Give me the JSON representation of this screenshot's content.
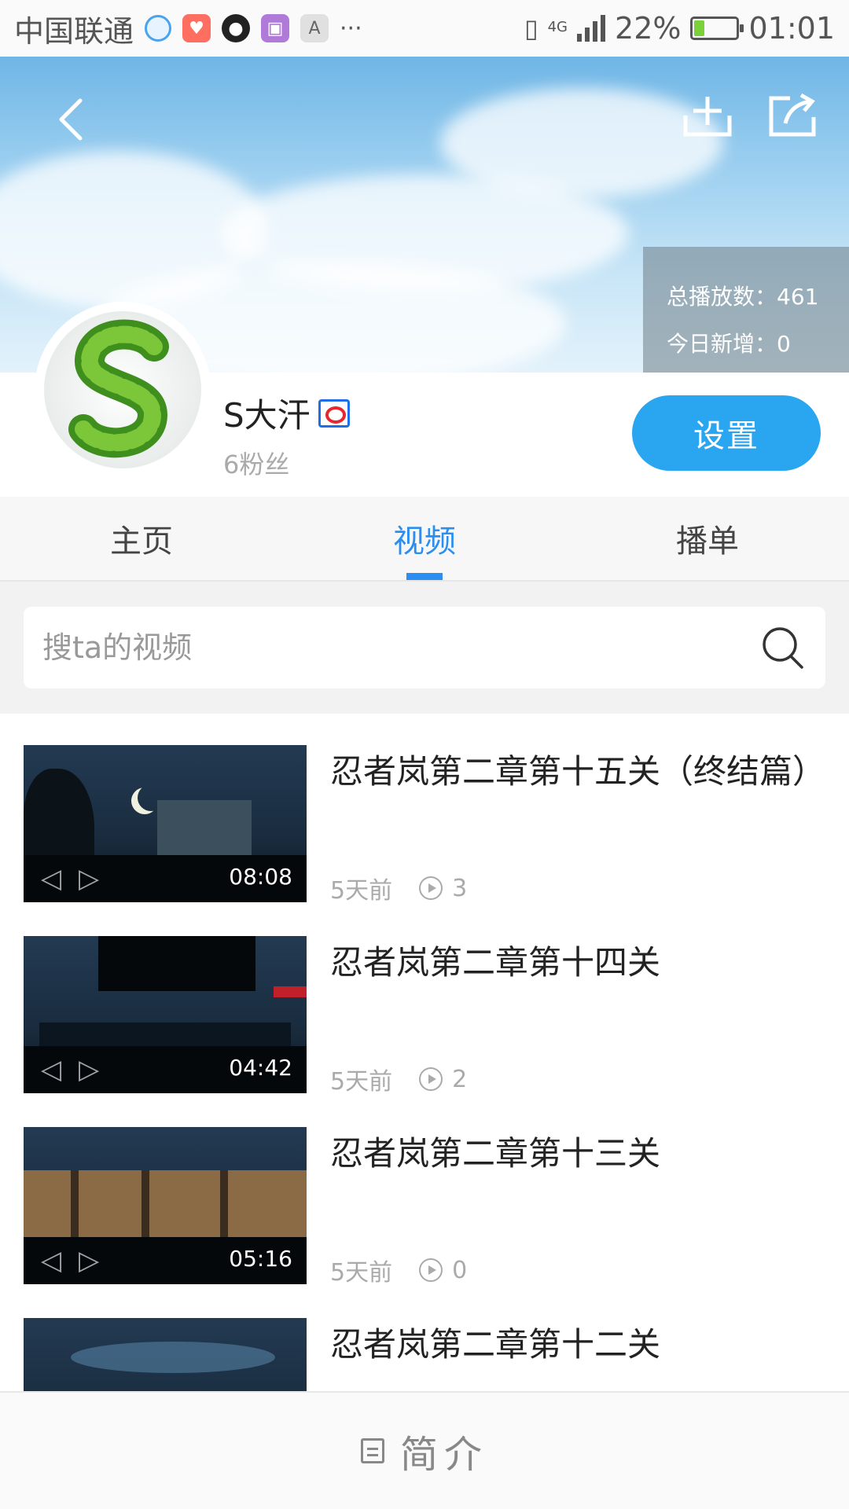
{
  "status_bar": {
    "carrier": "中国联通",
    "network": "4G",
    "battery": "22%",
    "time": "01:01",
    "more": "···"
  },
  "header": {
    "stats": {
      "total_plays_label": "总播放数：",
      "total_plays": "461",
      "today_new_label": "今日新增：",
      "today_new": "0"
    }
  },
  "profile": {
    "name": "S大汗",
    "fans": "6粉丝",
    "settings_label": "设置"
  },
  "tabs": [
    {
      "label": "主页",
      "active": false
    },
    {
      "label": "视频",
      "active": true
    },
    {
      "label": "播单",
      "active": false
    }
  ],
  "search": {
    "placeholder": "搜ta的视频"
  },
  "videos": [
    {
      "title": "忍者岚第二章第十五关（终结篇）",
      "duration": "08:08",
      "age": "5天前",
      "plays": "3"
    },
    {
      "title": "忍者岚第二章第十四关",
      "duration": "04:42",
      "age": "5天前",
      "plays": "2"
    },
    {
      "title": "忍者岚第二章第十三关",
      "duration": "05:16",
      "age": "5天前",
      "plays": "0"
    },
    {
      "title": "忍者岚第二章第十二关",
      "duration": "",
      "age": "",
      "plays": ""
    }
  ],
  "bottom": {
    "label": "简介"
  }
}
